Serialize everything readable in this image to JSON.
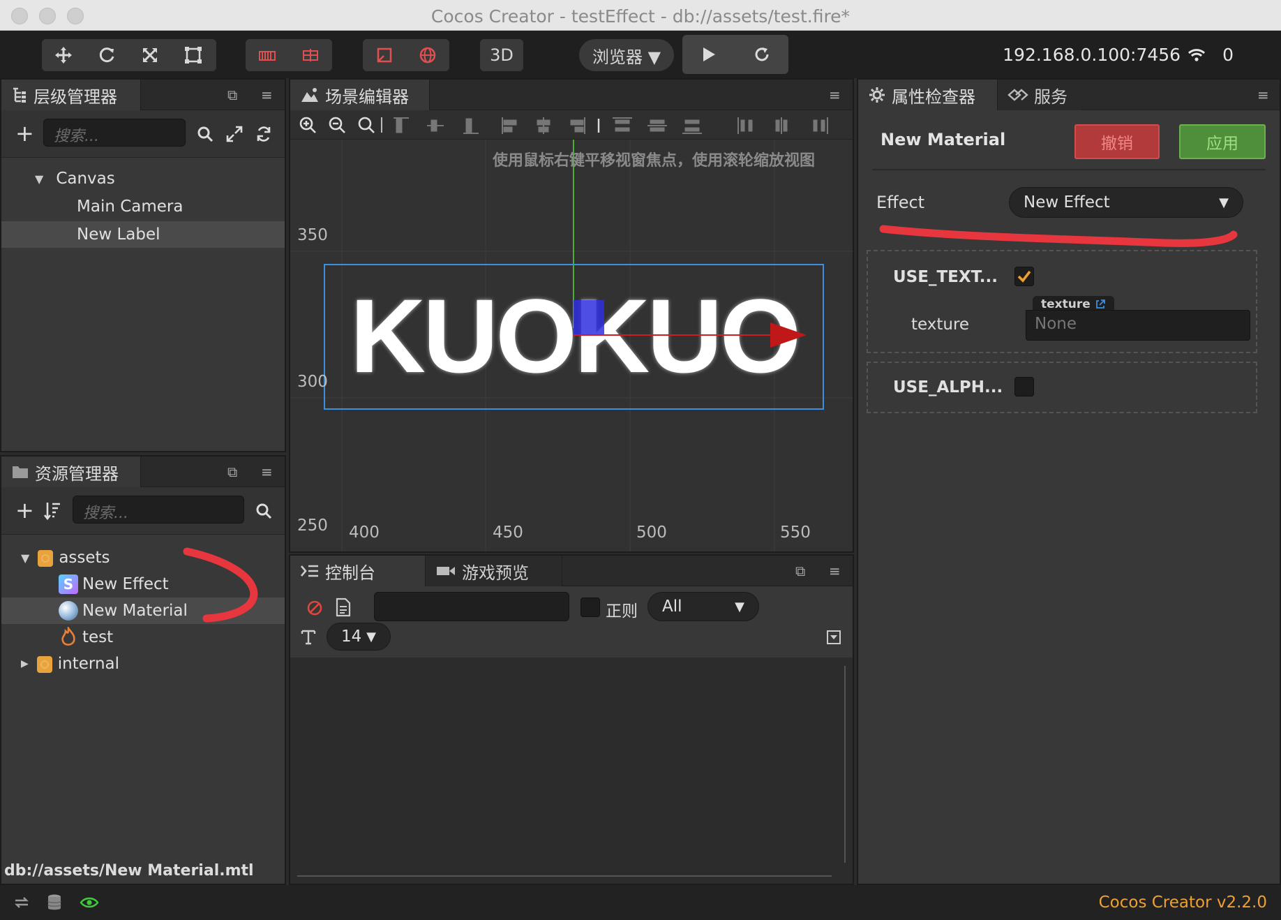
{
  "window": {
    "title": "Cocos Creator - testEffect - db://assets/test.fire*"
  },
  "toolbar": {
    "btn_3d": "3D",
    "browser_select": "浏览器 ▼",
    "ip": "192.168.0.100:7456",
    "device_count": "0"
  },
  "hierarchy": {
    "tab_label": "层级管理器",
    "search_placeholder": "搜索...",
    "items": [
      "Canvas",
      "Main Camera",
      "New Label"
    ]
  },
  "assets": {
    "tab_label": "资源管理器",
    "search_placeholder": "搜索...",
    "items": [
      "assets",
      "New Effect",
      "New Material",
      "test",
      "internal"
    ],
    "status_path": "db://assets/New Material.mtl"
  },
  "scene": {
    "tab_label": "场景编辑器",
    "hint": "使用鼠标右键平移视窗焦点，使用滚轮缩放视图",
    "y_ticks": [
      "350",
      "300",
      "250"
    ],
    "x_ticks": [
      "400",
      "450",
      "500",
      "550"
    ],
    "label_text": "KUOKUO"
  },
  "console": {
    "tab_console": "控制台",
    "tab_preview": "游戏预览",
    "regex_label": "正则",
    "filter_select": "All",
    "font_size": "14"
  },
  "inspector": {
    "tab_inspector": "属性检查器",
    "tab_services": "服务",
    "title": "New Material",
    "revert_label": "撤销",
    "apply_label": "应用",
    "effect_label": "Effect",
    "effect_value": "New Effect",
    "use_texture_label": "USE_TEXT...",
    "use_texture_checked": true,
    "texture_type": "texture",
    "texture_label": "texture",
    "texture_value": "None",
    "use_alpha_label": "USE_ALPH...",
    "use_alpha_checked": false
  },
  "footer": {
    "version": "Cocos Creator v2.2.0"
  },
  "colors": {
    "accent_orange": "#f0a030",
    "annotation_red": "#e8363f",
    "revert_red": "#b33a3a",
    "apply_green": "#4f8f3a"
  }
}
